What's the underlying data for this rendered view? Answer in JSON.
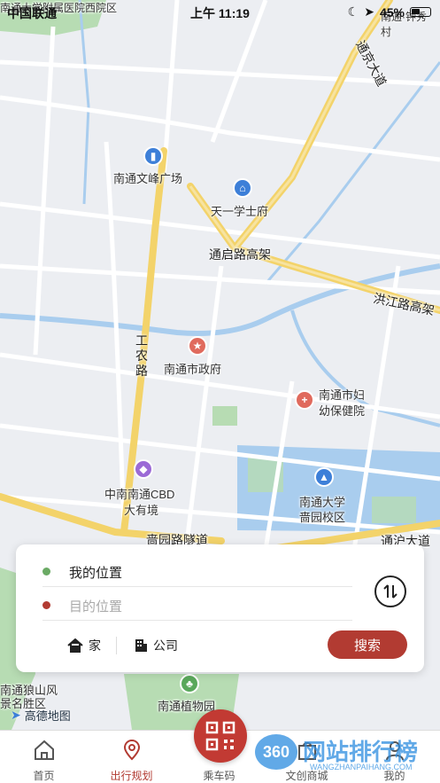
{
  "status_bar": {
    "carrier": "中国联通",
    "time": "上午 11:19",
    "battery": "45%"
  },
  "map": {
    "labels": {
      "top_left": "南通大学附属医院西院区",
      "top_right": "南通·钟秀村",
      "wenfeng": "南通文峰广场",
      "tianyi": "天一学士府",
      "tongqi": "通启路高架",
      "hongjiang": "洪江路高架",
      "govt": "南通市政府",
      "maternal_1": "南通市妇",
      "maternal_2": "幼保健院",
      "cbd_1": "中南南通CBD",
      "cbd_2": "大有境",
      "univ_1": "南通大学",
      "univ_2": "啬园校区",
      "seyuan_tunnel": "啬园路隧道",
      "tonghu": "通沪大道",
      "langshan_1": "南通狼山风",
      "langshan_2": "景名胜区",
      "botanic": "南通植物园",
      "tongjing": "通京大道",
      "gongnong": "工农路"
    },
    "provider": "高德地图"
  },
  "panel": {
    "my_location": "我的位置",
    "destination_placeholder": "目的位置",
    "home_label": "家",
    "company_label": "公司",
    "search_label": "搜索"
  },
  "tabbar": {
    "items": [
      {
        "label": "首页"
      },
      {
        "label": "出行规划"
      },
      {
        "label": "乘车码"
      },
      {
        "label": "文创商城"
      },
      {
        "label": "我的"
      }
    ]
  },
  "watermark": {
    "badge": "360",
    "title": "网站排行榜",
    "subtitle": "WANGZHANPAIHANG.COM"
  },
  "colors": {
    "accent": "#b23b32",
    "origin_dot": "#6aaa64",
    "dest_dot": "#b23b32",
    "road_major": "#f3d36a",
    "water": "#a9cdee",
    "park": "#b7dcb3"
  }
}
